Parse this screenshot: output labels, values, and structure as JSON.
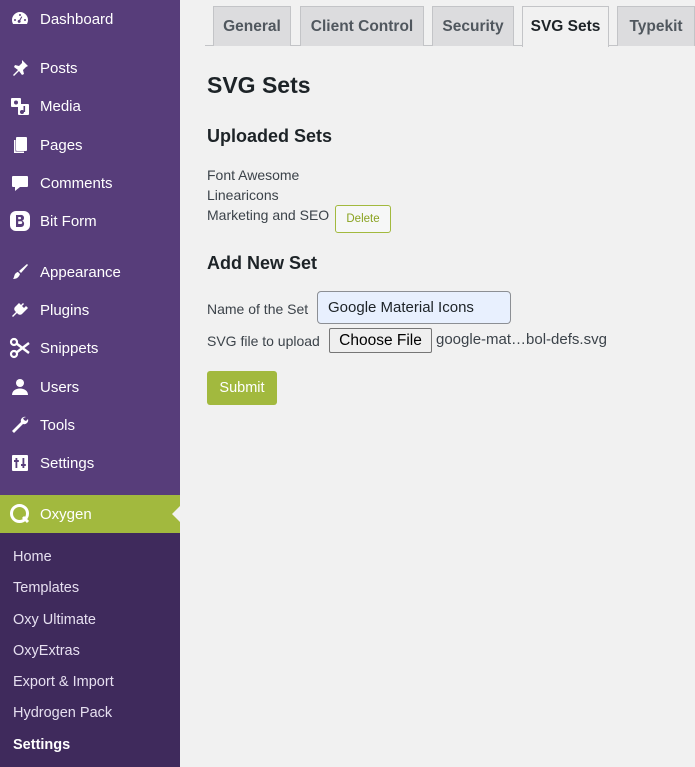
{
  "sidebar": {
    "items": [
      {
        "label": "Dashboard",
        "icon": "dashboard-icon"
      },
      {
        "label": "Posts",
        "icon": "pin-icon"
      },
      {
        "label": "Media",
        "icon": "media-icon"
      },
      {
        "label": "Pages",
        "icon": "pages-icon"
      },
      {
        "label": "Comments",
        "icon": "comment-icon"
      },
      {
        "label": "Bit Form",
        "icon": "bit-form-icon"
      },
      {
        "label": "Appearance",
        "icon": "brush-icon"
      },
      {
        "label": "Plugins",
        "icon": "plug-icon"
      },
      {
        "label": "Snippets",
        "icon": "scissors-icon"
      },
      {
        "label": "Users",
        "icon": "user-icon"
      },
      {
        "label": "Tools",
        "icon": "wrench-icon"
      },
      {
        "label": "Settings",
        "icon": "sliders-icon"
      },
      {
        "label": "Oxygen",
        "icon": "oxygen-icon"
      }
    ],
    "submenu": [
      "Home",
      "Templates",
      "Oxy Ultimate",
      "OxyExtras",
      "Export & Import",
      "Hydrogen Pack",
      "Settings"
    ]
  },
  "tabs": [
    "General",
    "Client Control",
    "Security",
    "SVG Sets",
    "Typekit"
  ],
  "page_title": "SVG Sets",
  "uploaded": {
    "title": "Uploaded Sets",
    "sets": [
      "Font Awesome",
      "Linearicons",
      "Marketing and SEO"
    ],
    "delete_label": "Delete"
  },
  "add_new": {
    "title": "Add New Set",
    "name_label": "Name of the Set",
    "name_value": "Google Material Icons",
    "file_label": "SVG file to upload",
    "choose_label": "Choose File",
    "file_name": "google-mat…bol-defs.svg",
    "submit_label": "Submit"
  },
  "colors": {
    "sidebar": "#573d7a",
    "submenu": "#3f2a5c",
    "accent": "#a2b93e"
  }
}
